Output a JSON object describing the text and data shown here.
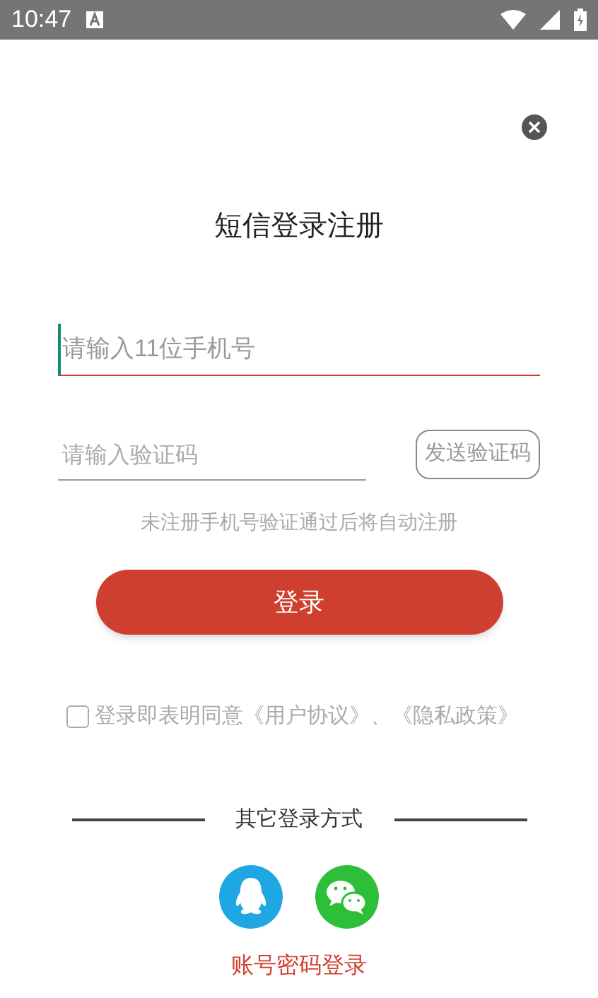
{
  "status_bar": {
    "time": "10:47"
  },
  "title": "短信登录注册",
  "phone_field": {
    "placeholder": "请输入11位手机号"
  },
  "code_field": {
    "placeholder": "请输入验证码"
  },
  "send_code_button": "发送验证码",
  "hint": "未注册手机号验证通过后将自动注册",
  "login_button": "登录",
  "agreement": {
    "checked": false,
    "text": "登录即表明同意《用户协议》、《隐私政策》"
  },
  "other_login": {
    "label": "其它登录方式",
    "methods": [
      {
        "kind": "qq"
      },
      {
        "kind": "wechat"
      }
    ]
  },
  "password_login_link": "账号密码登录"
}
